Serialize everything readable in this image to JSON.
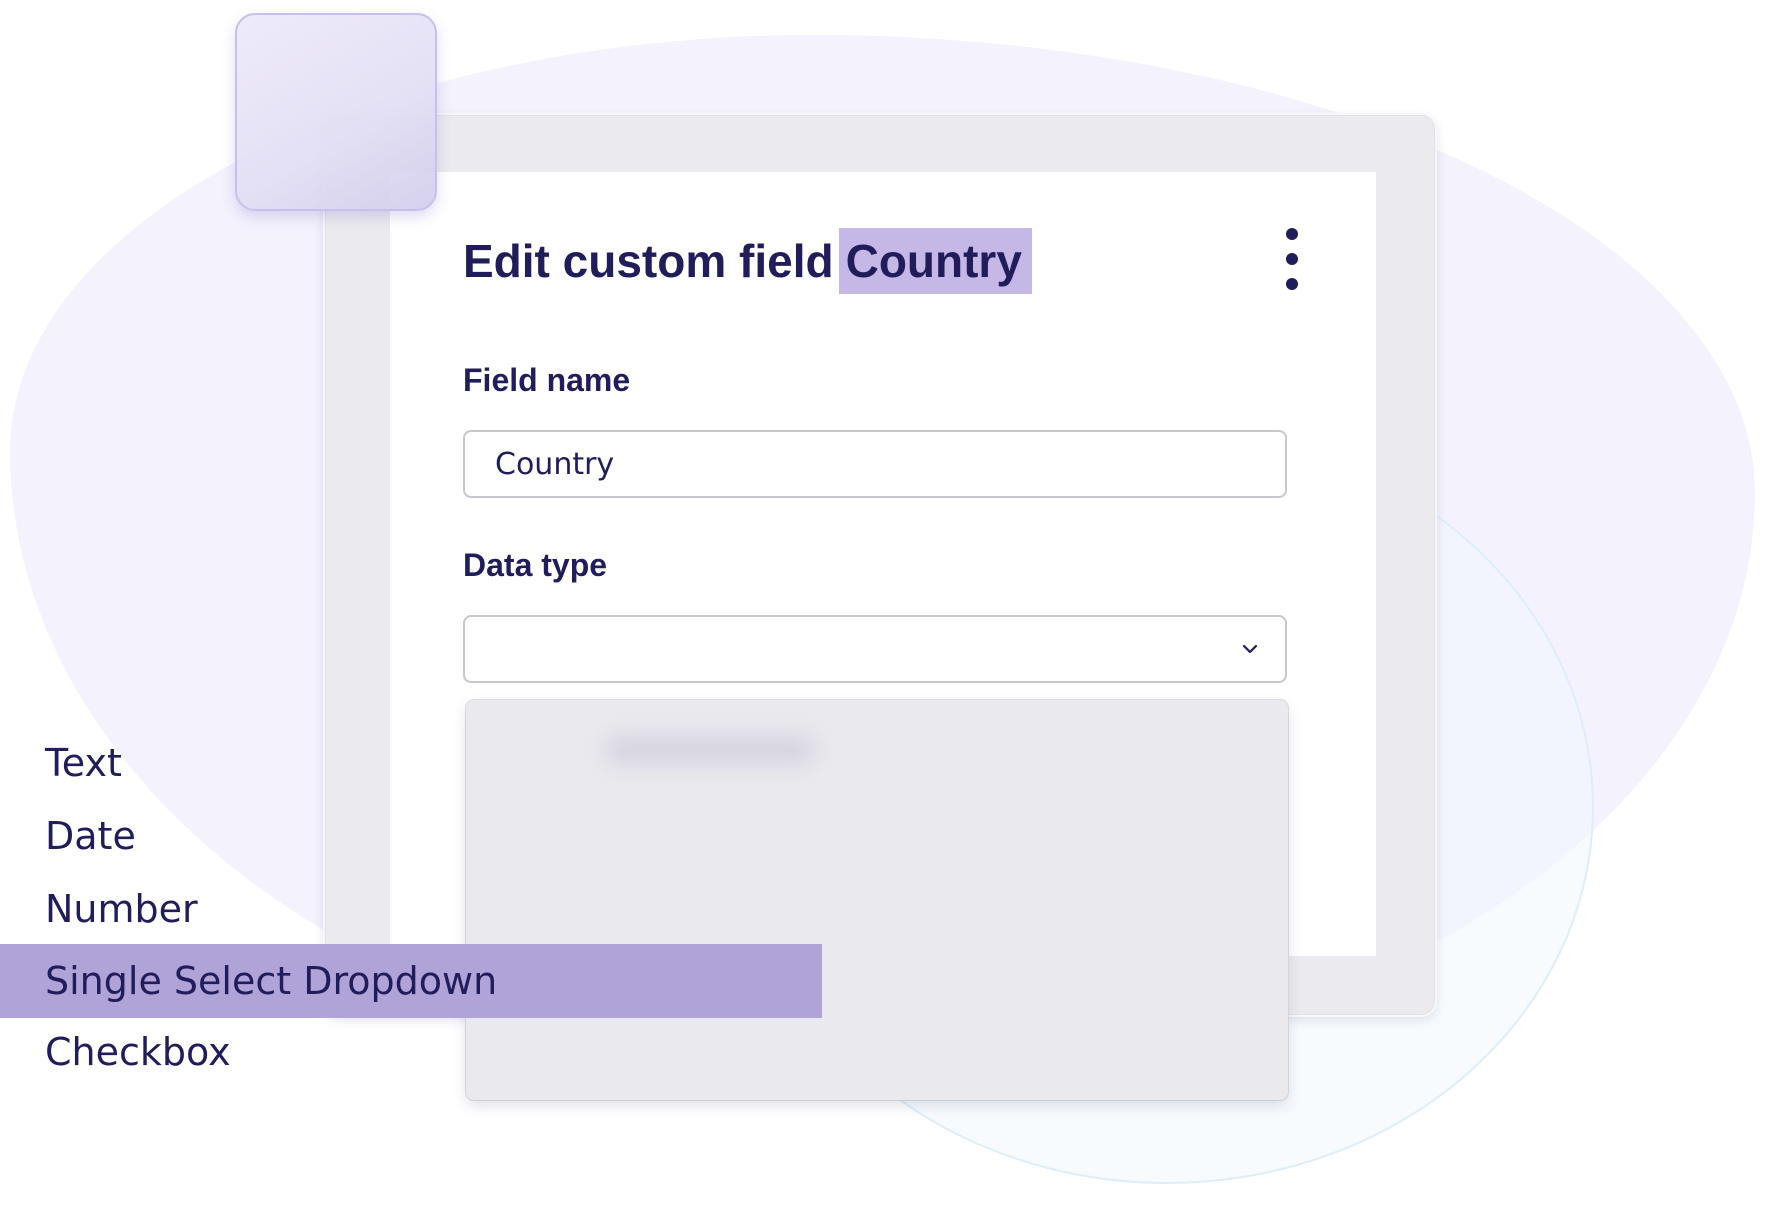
{
  "dialog": {
    "title_prefix": "Edit custom field",
    "title_highlight": "Country",
    "menu_icon": "more-vertical-icon"
  },
  "field_name": {
    "label": "Field name",
    "value": "Country"
  },
  "data_type": {
    "label": "Data type",
    "value": "",
    "dropdown_icon": "chevron-down-icon",
    "options": [
      {
        "label": "Text"
      },
      {
        "label": "Date"
      },
      {
        "label": "Number"
      },
      {
        "label": "Single Select Dropdown",
        "highlighted": true
      },
      {
        "label": "Checkbox"
      }
    ]
  },
  "colors": {
    "text": "#211c5a",
    "title_highlight": "#c5b8e6",
    "option_highlight": "#b0a3d8",
    "background_blob": "#f4f2fc"
  }
}
